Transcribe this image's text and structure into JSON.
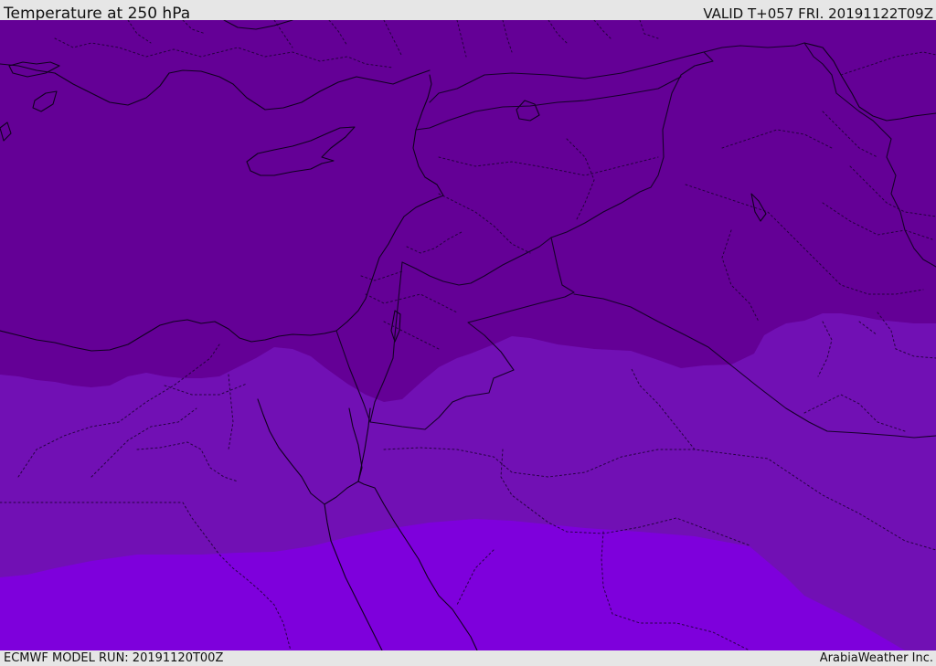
{
  "header": {
    "title": "Temperature at 250 hPa",
    "valid": "VALID T+057 FRI. 20191122T09Z"
  },
  "footer": {
    "model_run": "ECMWF MODEL RUN: 20191120T00Z",
    "credit": "ArabiaWeather Inc."
  },
  "map": {
    "colors": {
      "band_north": "#640096",
      "band_middle": "#7110b4",
      "band_south": "#7e00dc",
      "outline": "#10001f"
    }
  }
}
